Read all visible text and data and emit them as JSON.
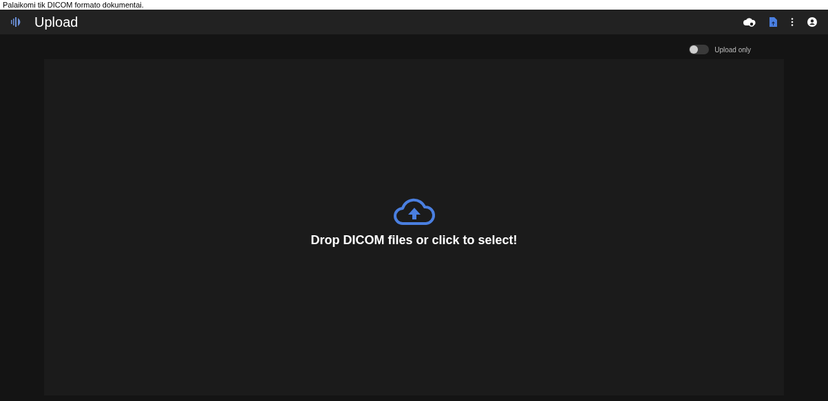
{
  "caption": "Palaikomi tik DICOM formato dokumentai.",
  "header": {
    "title": "Upload"
  },
  "upload_only": {
    "label": "Upload only",
    "on": false
  },
  "dropzone": {
    "text": "Drop DICOM files or click to select!"
  }
}
